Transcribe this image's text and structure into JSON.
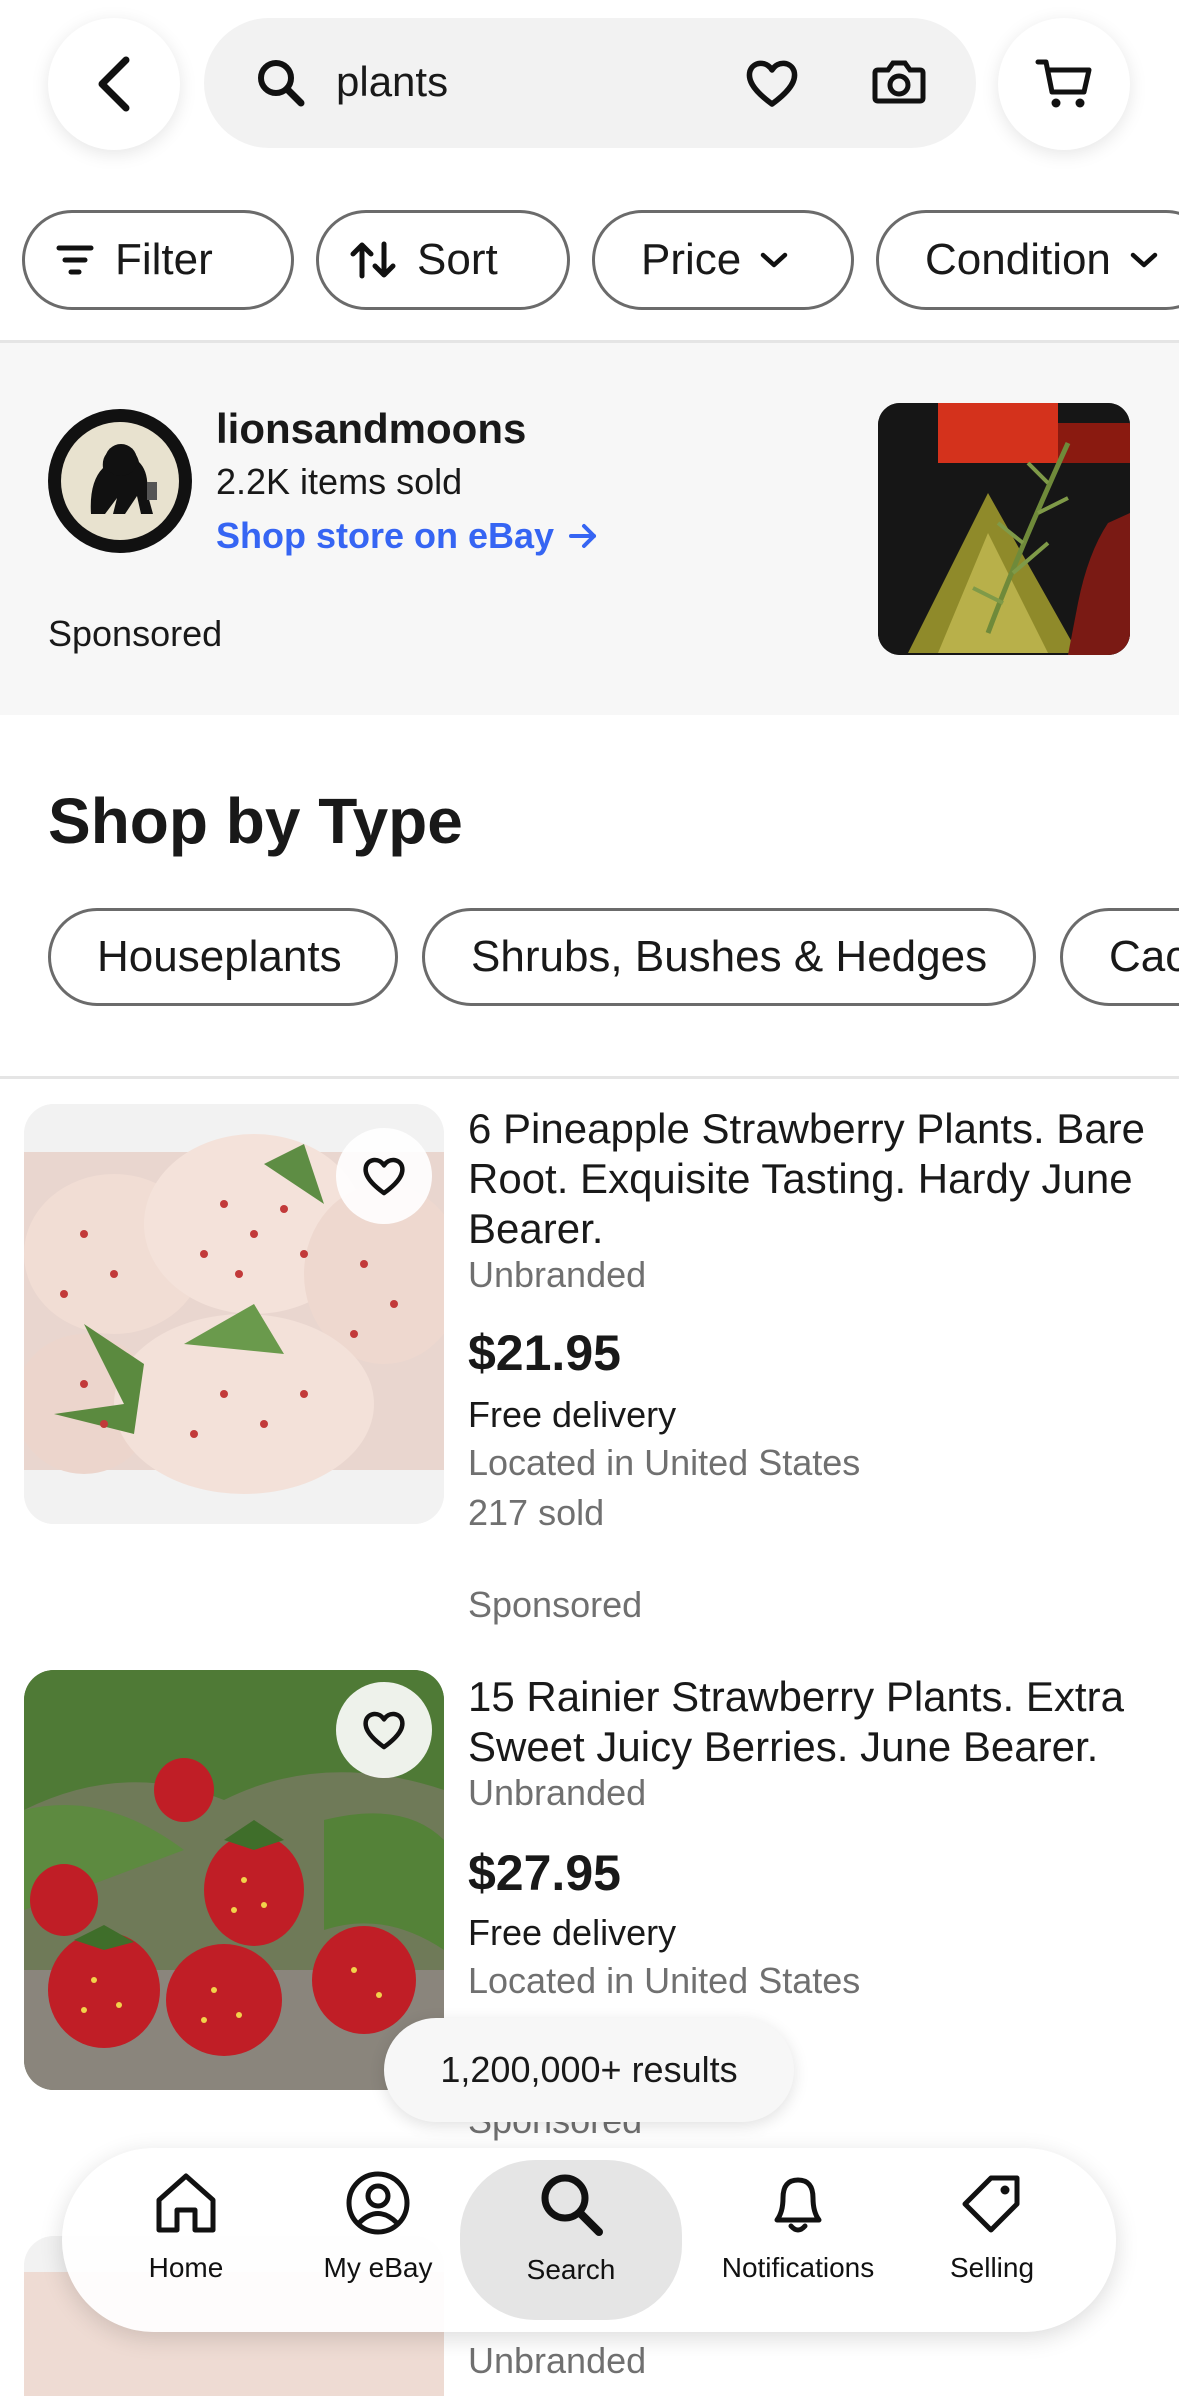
{
  "header": {
    "search_query": "plants"
  },
  "filters": {
    "chips": [
      {
        "label": "Filter"
      },
      {
        "label": "Sort"
      },
      {
        "label": "Price"
      },
      {
        "label": "Condition"
      }
    ]
  },
  "store_banner": {
    "name": "lionsandmoons",
    "items_sold": "2.2K items sold",
    "link": "Shop store on eBay",
    "sponsored": "Sponsored"
  },
  "shop_by_type": {
    "title": "Shop by Type",
    "types": [
      "Houseplants",
      "Shrubs, Bushes & Hedges",
      "Cac"
    ]
  },
  "listings": [
    {
      "title": "6 Pineapple Strawberry Plants. Bare Root. Exquisite Tasting. Hardy June Bearer.",
      "brand": "Unbranded",
      "price": "$21.95",
      "delivery": "Free delivery",
      "location": "Located in United States",
      "sold": "217 sold",
      "sponsored": "Sponsored"
    },
    {
      "title": "15 Rainier Strawberry Plants. Extra Sweet Juicy Berries. June Bearer.",
      "brand": "Unbranded",
      "price": "$27.95",
      "delivery": "Free delivery",
      "location": "Located in United States",
      "sold": "",
      "sponsored": "Sponsored"
    },
    {
      "brand": "Unbranded"
    }
  ],
  "results_count": "1,200,000+ results",
  "bottom_nav": {
    "items": [
      {
        "label": "Home",
        "icon": "home-icon"
      },
      {
        "label": "My eBay",
        "icon": "profile-icon"
      },
      {
        "label": "Search",
        "icon": "search-icon"
      },
      {
        "label": "Notifications",
        "icon": "bell-icon"
      },
      {
        "label": "Selling",
        "icon": "tag-icon"
      }
    ],
    "active": "Search"
  },
  "colors": {
    "link_blue": "#3665f3",
    "muted_text": "#707070",
    "border": "#6b6b6b"
  }
}
